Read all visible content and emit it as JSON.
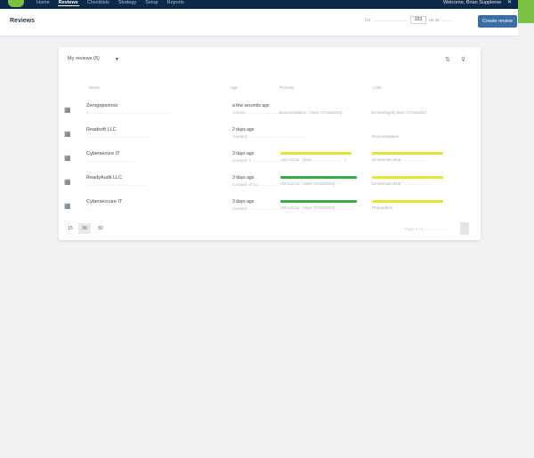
{
  "nav": {
    "links": [
      "Home",
      "Reviews",
      "Checklists",
      "Strategy",
      "Setup",
      "Reports"
    ],
    "active_index": 1,
    "welcome": "Welcome, Brian Suppleroe",
    "close_label": "✕"
  },
  "header": {
    "title": "Reviews",
    "label_prefix": "Us ……………………",
    "count": "333",
    "label_suffix": "us ss ………",
    "create_button": "Create review"
  },
  "filter": {
    "label": "My reviews (5)",
    "caret": "▼"
  },
  "columns": [
    "Name",
    "Age",
    "Process",
    "LOD"
  ],
  "rows": [
    {
      "name": "Zerogopsonoo",
      "sub": "1 ……………………………………………………",
      "modified": "a few seconds ago",
      "modified_sub": "Creator: ………………………",
      "process": "Documentation    ·  (Due: 07/13/2024)",
      "lod": "Emmerlogrity         Due: 07/13/2024",
      "process_bar": "",
      "lod_bar": ""
    },
    {
      "name": "Readsoft LLC",
      "sub": "…………………………………………",
      "modified": "2 days ago",
      "modified_sub": "Created: ………………………",
      "process": "…………………",
      "lod": "Documentation",
      "process_bar": "",
      "lod_bar": ""
    },
    {
      "name": "Cybersecure IT",
      "sub": "………………………………",
      "modified": "3 days ago",
      "modified_sub": "Created: 1 ………………………",
      "process": "AM LoCoo · (Due ……………………)",
      "lod": "Emmersion      Due: ………………",
      "process_bar": "#e8e23a",
      "lod_bar": "#e8e23a"
    },
    {
      "name": "ReadyAudit LLC",
      "sub": "………………………………………",
      "modified": "3 days ago",
      "modified_sub": "Created: 07/11 ……………",
      "process": "AM LoCoo · (Due: 07/12/2024)",
      "lod": "Emmersion      Due: ………………",
      "process_bar": "#3daa4a",
      "lod_bar": "#e8e23a"
    },
    {
      "name": "Cyberseccure IT",
      "sub": "…",
      "modified": "3 days ago",
      "modified_sub": "Created: ……………………",
      "process": "AM LoCoo · (Due: 07/22/2024)",
      "lod": "Preparation",
      "process_bar": "#3daa4a",
      "lod_bar": "#e8e23a"
    }
  ],
  "pagination": {
    "sizes": [
      "15",
      "30",
      "50"
    ],
    "selected_index": 1,
    "page_info": "Page 1 / 1 ………………"
  },
  "colors": {
    "nav_bg": "#0e2a4a",
    "accent_green": "#79c143",
    "button_blue": "#3a6ea5"
  }
}
